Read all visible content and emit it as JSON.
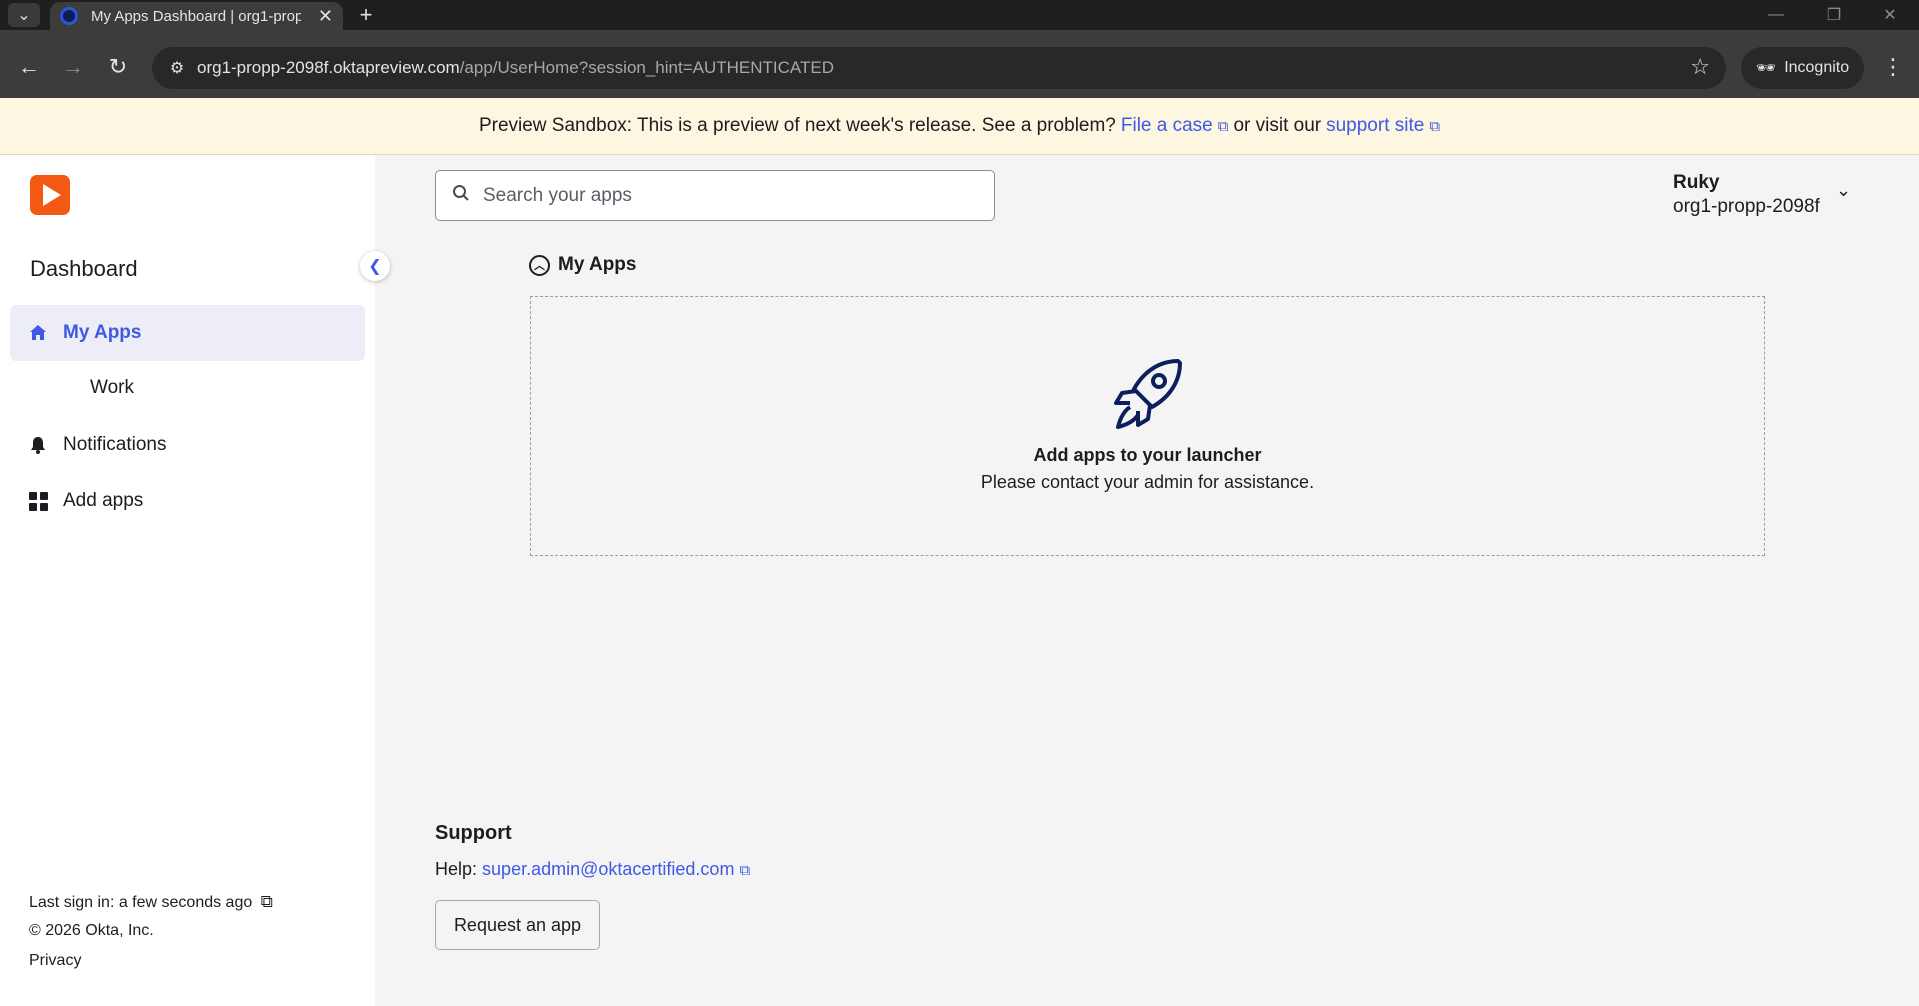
{
  "browser": {
    "tab_title": "My Apps Dashboard | org1-propp-2098f",
    "tab_close": "✕",
    "new_tab": "+",
    "url_host": "org1-propp-2098f.oktapreview.com",
    "url_path": "/app/UserHome?session_hint=AUTHENTICATED",
    "incognito_label": "Incognito"
  },
  "banner": {
    "text_before": "Preview Sandbox: This is a preview of next week's release. See a problem?",
    "link1": "File a case",
    "text_middle": "or visit our",
    "link2": "support site"
  },
  "sidebar": {
    "title": "Dashboard",
    "items": [
      {
        "label": "My Apps",
        "icon": "home-icon"
      },
      {
        "label": "Work"
      },
      {
        "label": "Notifications",
        "icon": "bell-icon"
      },
      {
        "label": "Add apps",
        "icon": "grid-icon"
      }
    ],
    "last_sign_in": "Last sign in: a few seconds ago",
    "copyright": "© 2026 Okta, Inc.",
    "privacy": "Privacy"
  },
  "search": {
    "placeholder": "Search your apps"
  },
  "user": {
    "name": "Ruky",
    "org": "org1-propp-2098f"
  },
  "main": {
    "section_title": "My Apps",
    "empty_title": "Add apps to your launcher",
    "empty_subtitle": "Please contact your admin for assistance."
  },
  "support": {
    "title": "Support",
    "help_label": "Help:",
    "help_email": "super.admin@oktacertified.com",
    "request_button": "Request an app"
  },
  "colors": {
    "accent": "#3f59e4",
    "logo": "#f25a14",
    "banner_bg": "#fdf6e0"
  }
}
